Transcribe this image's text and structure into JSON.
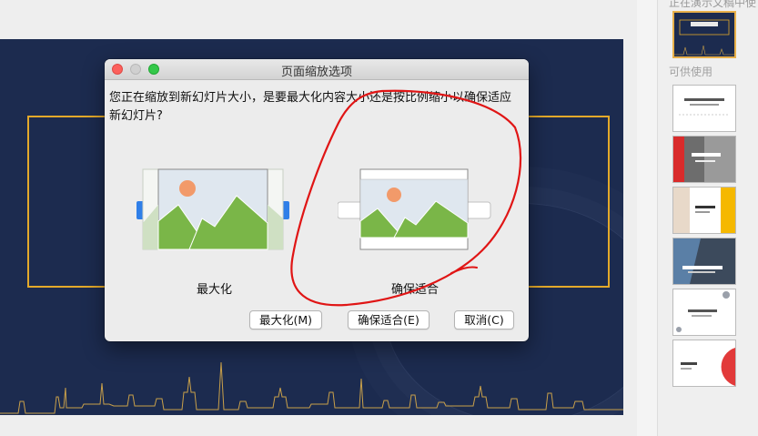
{
  "dialog": {
    "title": "页面缩放选项",
    "message": "您正在缩放到新幻灯片大小，是要最大化内容大小还是按比例缩小以确保适应新幻灯片?",
    "options": [
      {
        "id": "maximize",
        "label": "最大化"
      },
      {
        "id": "ensure-fit",
        "label": "确保适合"
      }
    ],
    "buttons": {
      "maximize": "最大化(M)",
      "ensure_fit": "确保适合(E)",
      "cancel": "取消(C)"
    }
  },
  "panel": {
    "cut_title": "正在演示文稿中使",
    "section_label": "可供使用",
    "thumbnails": [
      {
        "name": "current-layout",
        "selected": true
      },
      {
        "name": "layout-1"
      },
      {
        "name": "layout-2"
      },
      {
        "name": "layout-3"
      },
      {
        "name": "layout-4"
      },
      {
        "name": "layout-5"
      },
      {
        "name": "layout-6"
      }
    ]
  },
  "colors": {
    "slide_bg": "#1c2b4f",
    "frame": "#e3a92a",
    "annotation": "#e01515",
    "accent_blue": "#2f7fe8"
  }
}
